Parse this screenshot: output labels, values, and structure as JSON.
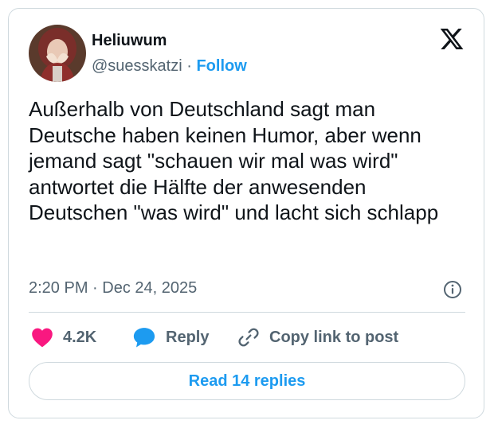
{
  "author": {
    "display_name": "Heliuwum",
    "handle": "@suesskatzi",
    "separator": "·",
    "follow_label": "Follow"
  },
  "tweet": {
    "text": "Außerhalb von Deutschland sagt man Deutsche haben keinen Humor, aber wenn jemand sagt \"schauen wir mal was wird\" antwortet die Hälfte der anwesenden Deutschen \"was wird\" und lacht sich schlapp",
    "timestamp": "2:20 PM · Dec 24, 2025"
  },
  "actions": {
    "like_count": "4.2K",
    "reply_label": "Reply",
    "copy_link_label": "Copy link to post"
  },
  "read_replies_label": "Read 14 replies",
  "icons": {
    "brand": "x-logo-icon",
    "info": "info-icon",
    "like": "heart-icon",
    "reply": "speech-bubble-icon",
    "copy": "link-icon"
  },
  "colors": {
    "accent": "#1d9bf0",
    "like": "#f91880",
    "text": "#0f1419",
    "secondary": "#536471",
    "border": "#cfd9de"
  }
}
